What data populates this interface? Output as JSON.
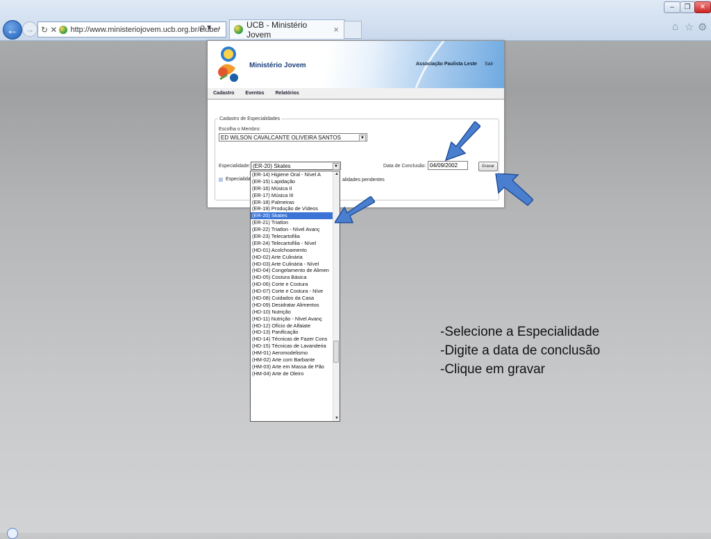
{
  "browser": {
    "url": "http://www.ministeriojovem.ucb.org.br/clube/",
    "address_tail": "ρ ▾ →",
    "tab_title": "UCB - Ministério Jovem",
    "tab_close": "×",
    "back_icon": "←",
    "forward_icon": "→",
    "refresh_stop": "↻ ✕",
    "window_buttons": [
      "–",
      "❐",
      "✕"
    ],
    "tool_icons": [
      "⌂",
      "☆",
      "⚙"
    ]
  },
  "site": {
    "title": "Ministério Jovem",
    "association": "Associação Paulista Leste",
    "logout": "Sair",
    "menu": [
      "Cadastro",
      "Eventos",
      "Relatórios"
    ]
  },
  "form": {
    "legend": "Cadastro de Especialidades",
    "member_label": "Escolha o Membro:",
    "member_value": "ED WILSON CAVALCANTE OLIVEIRA SANTOS",
    "specialty_label": "Especialidade:",
    "specialty_value": "(ER-20) Skates",
    "date_label": "Data de Conclusão:",
    "date_value": "04/09/2002",
    "save_button": "Gravar",
    "legend_left": "Especialida",
    "legend_right": "alidades pendentes"
  },
  "dropdown": {
    "options": [
      "(ER-14) Higiene Oral - Nível A",
      "(ER-15) Lapidação",
      "(ER-16) Música II",
      "(ER-17) Música III",
      "(ER-18) Palmeiras",
      "(ER-19) Produção de Vídeos",
      "(ER-20) Skates",
      "(ER-21) Triatlon",
      "(ER-22) Triatlon - Nível Avanç",
      "(ER-23) Telecartofilia",
      "(ER-24) Telecartofilia - Nível",
      "(HD-01) Acolchoamento",
      "(HD-02) Arte Culinária",
      "(HD-03) Arte Culinária - Nível",
      "(HD-04) Congelamento de Alimen",
      "(HD-05) Costura Básica",
      "(HD-06) Corte e Costura",
      "(HD-07) Corte e Costura - Níve",
      "(HD-08) Cuidados da Casa",
      "(HD-09) Desidratar Alimentos",
      "(HD-10) Nutrição",
      "(HD-11) Nutrição - Nível Avanç",
      "(HD-12) Ofício de Alfaiate",
      "(HD-13) Panificação",
      "(HD-14) Técnicas de Fazer Cons",
      "(HD-15) Técnicas de Lavanderia",
      "(HM-01) Aeromodelismo",
      "(HM-02) Arte com Barbante",
      "(HM-03) Arte em Massa de Pão",
      "(HM-04) Arte de Oleiro"
    ],
    "selected_index": 6
  },
  "instructions": [
    "-Selecione a Especialidade",
    "-Digite a data de conclusão",
    "-Clique em gravar"
  ],
  "colors": {
    "accent_blue": "#3b74d6",
    "arrow_blue": "#4a7fd0",
    "title_blue": "#1a3f7a"
  }
}
